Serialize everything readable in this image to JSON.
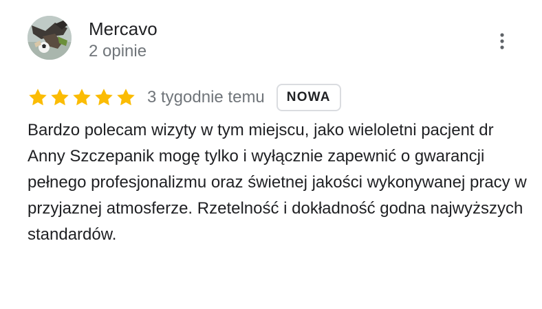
{
  "reviewer": {
    "name": "Mercavo",
    "meta": "2 opinie",
    "avatar_icon": "avatar-photo"
  },
  "menu": {
    "icon": "more-vert-icon"
  },
  "rating": {
    "stars": 5,
    "max_stars": 5,
    "star_color": "#fbbc04",
    "date": "3 tygodnie temu",
    "badge": "NOWA"
  },
  "review": {
    "text": "Bardzo polecam wizyty w tym miejscu, jako wieloletni pacjent dr Anny Szczepanik mogę tylko i wyłącznie zapewnić o gwarancji pełnego profesjonalizmu oraz świetnej jakości wykonywanej pracy w przyjaznej atmosferze. Rzetelność i dokładność godna najwyższych standardów."
  }
}
